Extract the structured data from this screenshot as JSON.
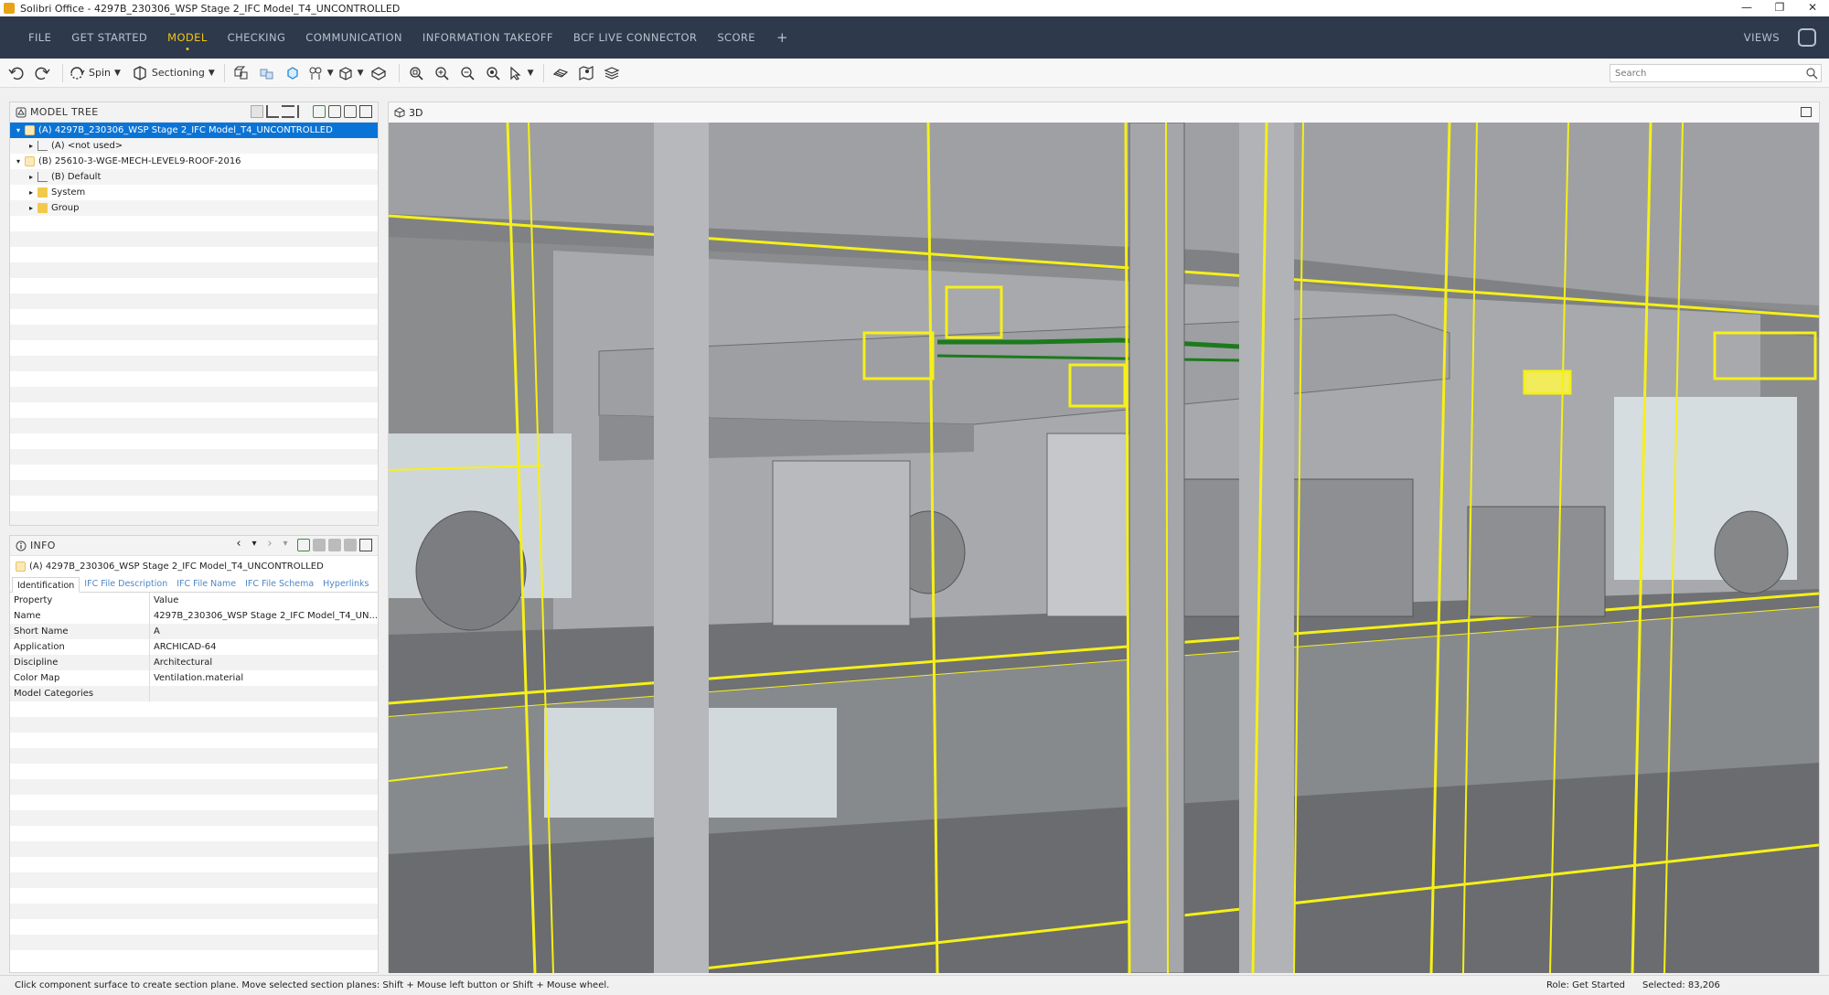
{
  "window": {
    "title": "Solibri Office - 4297B_230306_WSP Stage 2_IFC Model_T4_UNCONTROLLED",
    "minimize": "—",
    "restore": "❐",
    "close": "✕"
  },
  "menu": {
    "items": [
      {
        "label": "FILE",
        "active": false
      },
      {
        "label": "GET STARTED",
        "active": false
      },
      {
        "label": "MODEL",
        "active": true
      },
      {
        "label": "CHECKING",
        "active": false
      },
      {
        "label": "COMMUNICATION",
        "active": false
      },
      {
        "label": "INFORMATION TAKEOFF",
        "active": false
      },
      {
        "label": "BCF LIVE CONNECTOR",
        "active": false
      },
      {
        "label": "SCORE",
        "active": false
      }
    ],
    "add": "+",
    "views": "VIEWS"
  },
  "toolbar": {
    "spin_label": "Spin",
    "sectioning_label": "Sectioning",
    "search_placeholder": "Search"
  },
  "model_tree": {
    "title": "MODEL TREE",
    "rows": [
      {
        "label": "(A) 4297B_230306_WSP Stage 2_IFC Model_T4_UNCONTROLLED",
        "arrow": "▾",
        "indent": 0,
        "selected": true
      },
      {
        "label": "(A) <not used>",
        "arrow": "▸",
        "indent": 1,
        "selected": false
      },
      {
        "label": "(B) 25610-3-WGE-MECH-LEVEL9-ROOF-2016",
        "arrow": "▾",
        "indent": 0,
        "selected": false
      },
      {
        "label": "(B) Default",
        "arrow": "▸",
        "indent": 1,
        "selected": false
      },
      {
        "label": "System",
        "arrow": "▸",
        "indent": 1,
        "selected": false
      },
      {
        "label": "Group",
        "arrow": "▸",
        "indent": 1,
        "selected": false
      }
    ]
  },
  "info": {
    "title": "INFO",
    "nav_back": "‹",
    "nav_menu": "▾",
    "nav_fwd": "›",
    "nav_menu2": "▾",
    "selected_name": "(A) 4297B_230306_WSP Stage 2_IFC Model_T4_UNCONTROLLED",
    "tabs": [
      {
        "label": "Identification",
        "active": true
      },
      {
        "label": "IFC File Description",
        "active": false
      },
      {
        "label": "IFC File Name",
        "active": false
      },
      {
        "label": "IFC File Schema",
        "active": false
      },
      {
        "label": "Hyperlinks",
        "active": false
      }
    ],
    "columns": [
      "Property",
      "Value"
    ],
    "properties": [
      {
        "property": "Name",
        "value": "4297B_230306_WSP Stage 2_IFC Model_T4_UN..."
      },
      {
        "property": "Short Name",
        "value": "A"
      },
      {
        "property": "Application",
        "value": "ARCHICAD-64"
      },
      {
        "property": "Discipline",
        "value": "Architectural"
      },
      {
        "property": "Color Map",
        "value": "Ventilation.material"
      },
      {
        "property": "Model Categories",
        "value": ""
      }
    ]
  },
  "view3d": {
    "title": "3D"
  },
  "status": {
    "message": "Click component surface to create section plane. Move selected section planes: Shift + Mouse left button or Shift + Mouse wheel.",
    "role": "Role: Get Started",
    "selected": "Selected: 83,206"
  },
  "colors": {
    "menubar_bg": "#2e3a4b",
    "menu_active": "#f0c41b",
    "selection": "#0a74d6",
    "highlight_yellow": "#f5f018",
    "pipe_green": "#1c7a1c"
  }
}
